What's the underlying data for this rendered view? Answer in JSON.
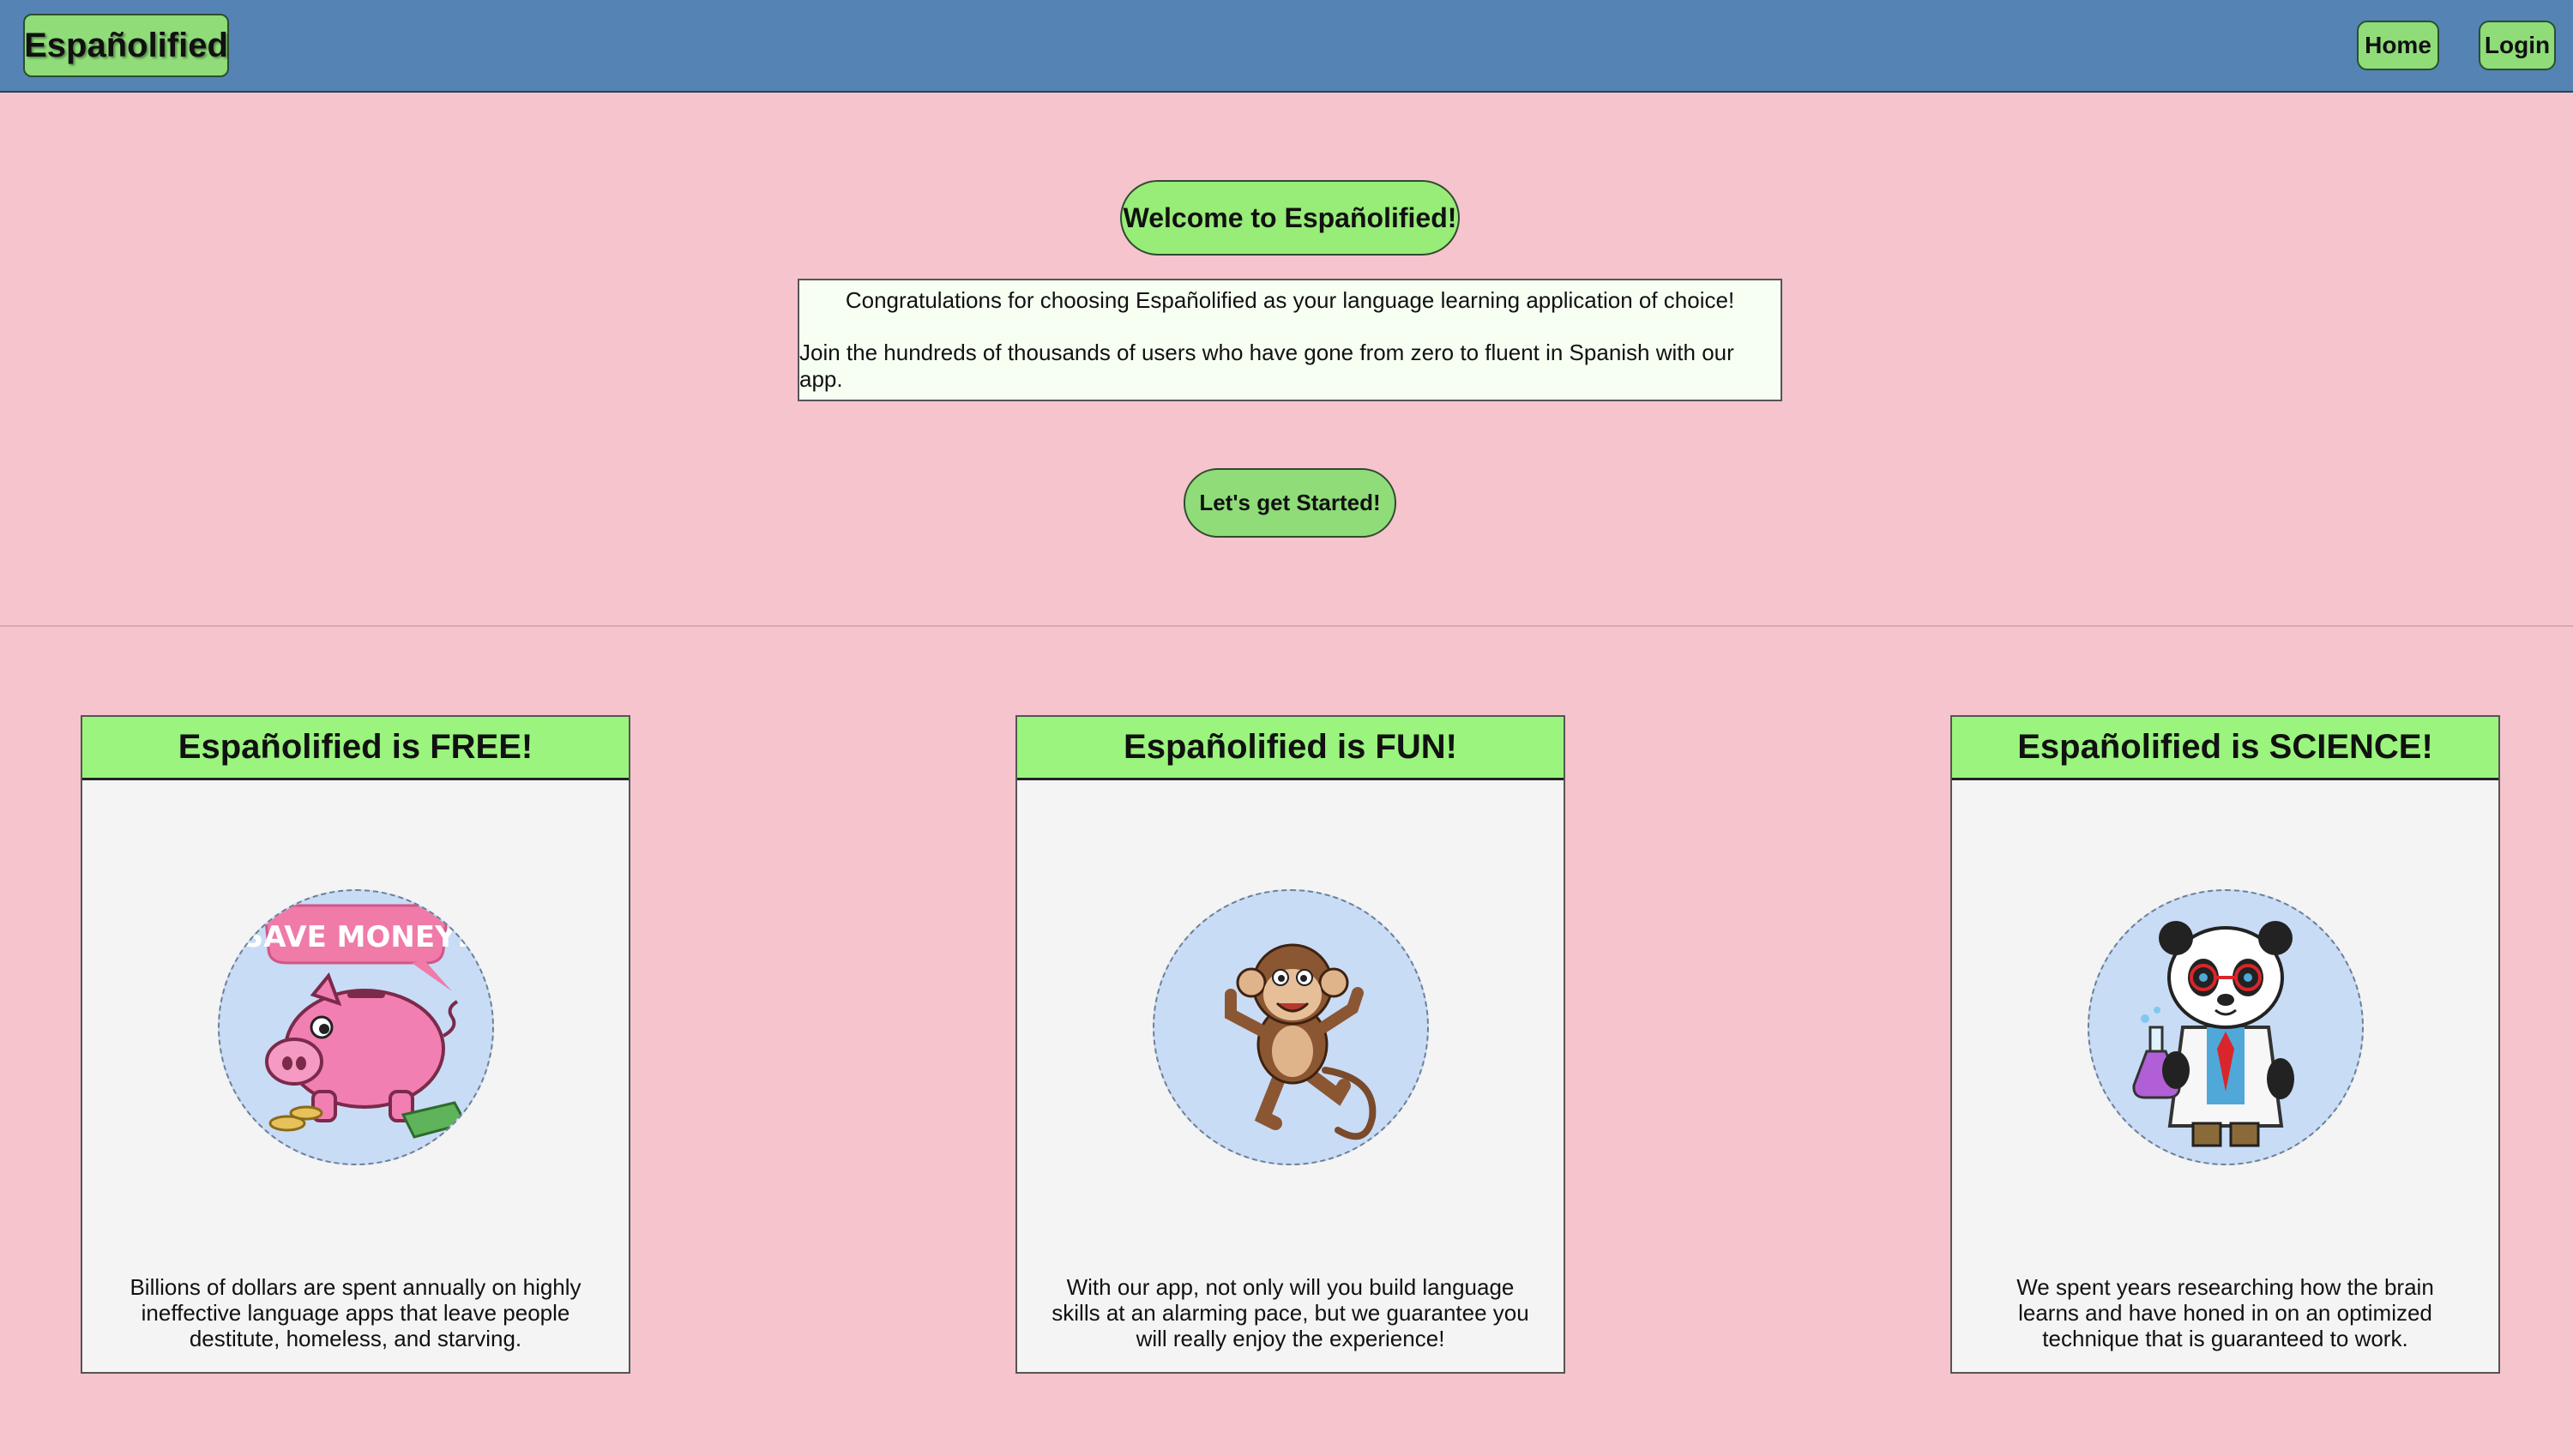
{
  "header": {
    "brand": "Españolified",
    "nav": {
      "home": "Home",
      "login": "Login"
    }
  },
  "hero": {
    "welcome": "Welcome to Españolified!",
    "intro_line1": "Congratulations for choosing Españolified as your language learning application of choice!",
    "intro_line2": "Join the hundreds of thousands of users who have gone from zero to fluent in Spanish with our app.",
    "cta": "Let's get Started!"
  },
  "features": [
    {
      "title": "Españolified is FREE!",
      "image_icon": "piggy-bank-icon",
      "image_caption": "SAVE MONEY!",
      "text": "Billions of dollars are spent annually on highly ineffective language apps that leave people destitute, homeless, and starving."
    },
    {
      "title": "Españolified is FUN!",
      "image_icon": "monkey-icon",
      "text": "With our app, not only will you build language skills at an alarming pace, but we guarantee you will really enjoy the experience!"
    },
    {
      "title": "Españolified is SCIENCE!",
      "image_icon": "scientist-panda-icon",
      "text": "We spent years researching how the brain learns and have honed in on an optimized technique that is guaranteed to work."
    }
  ],
  "colors": {
    "background": "#f5c4cc",
    "header": "#5483b4",
    "accent_green": "#8fdc79",
    "card_header": "#9af47e",
    "image_circle": "#c8dcf6"
  }
}
